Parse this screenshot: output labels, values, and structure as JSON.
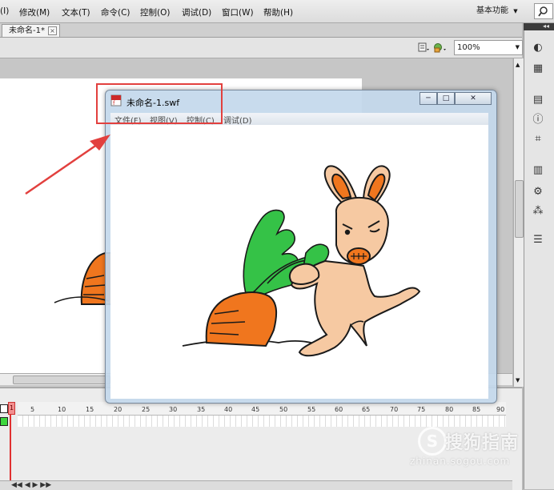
{
  "menubar": {
    "items": [
      "(I)",
      "修改(M)",
      "文本(T)",
      "命令(C)",
      "控制(O)",
      "调试(D)",
      "窗口(W)",
      "帮助(H)"
    ],
    "workspace": "基本功能",
    "workspace_arrow": "▼"
  },
  "doc_tab": {
    "label": "未命名-1*",
    "close": "×"
  },
  "editbar": {
    "zoom": "100%",
    "zoom_arrow": "▼"
  },
  "swf_window": {
    "title": "未命名-1.swf",
    "menu": [
      "文件(F)",
      "视图(V)",
      "控制(C)",
      "调试(D)"
    ],
    "btn_min": "─",
    "btn_max": "□",
    "btn_close": "✕"
  },
  "timeline": {
    "frame_marker": "1",
    "ticks": [
      "5",
      "10",
      "15",
      "20",
      "25",
      "30",
      "35",
      "40",
      "45",
      "50",
      "55",
      "60",
      "65",
      "70",
      "75",
      "80",
      "85",
      "90"
    ]
  },
  "watermark": {
    "logo": "S",
    "brand": "搜狗指南",
    "url": "zhinan.sogou.com"
  },
  "colors": {
    "highlight": "#e2403e",
    "carrot": "#f0761e",
    "leaves": "#35c247",
    "rabbit": "#f6c9a2"
  }
}
